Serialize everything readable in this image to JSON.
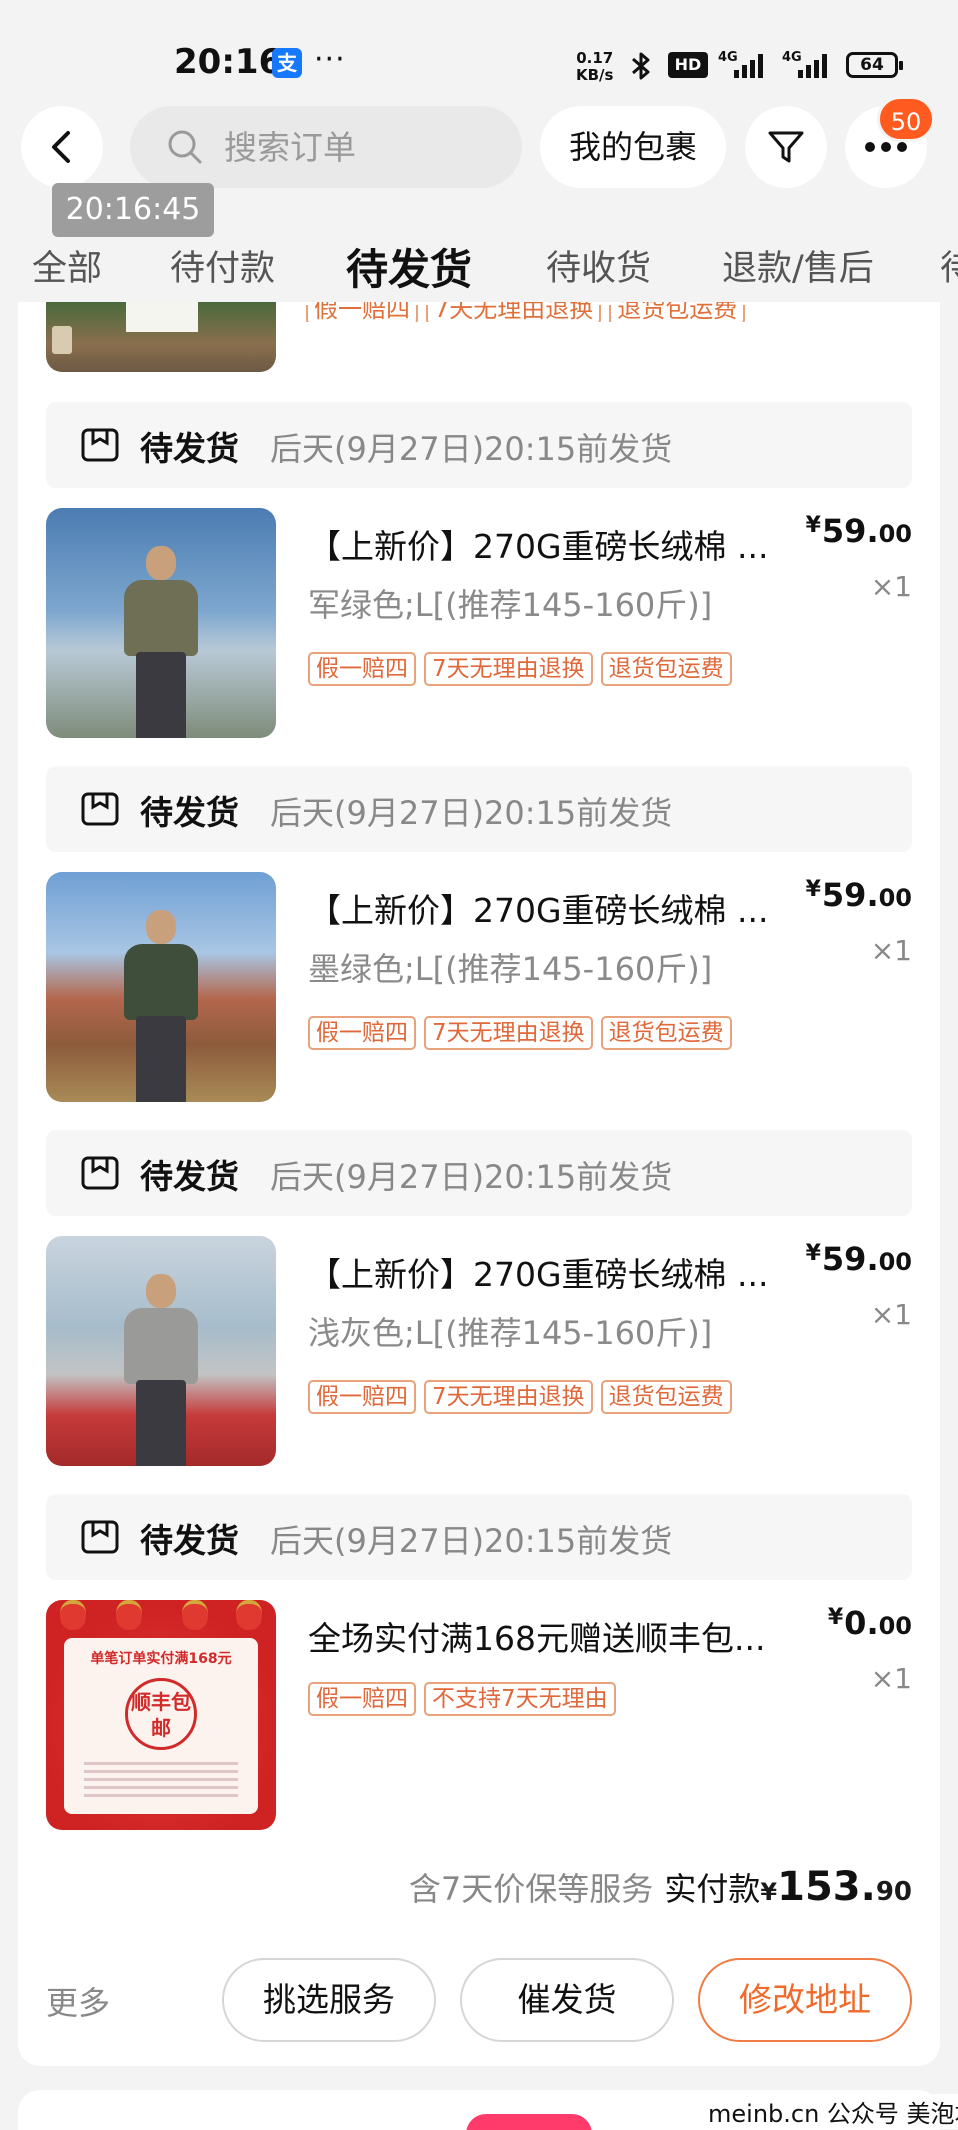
{
  "status_bar": {
    "time": "20:16",
    "app_icon_text": "支",
    "dots": "···",
    "net_speed_value": "0.17",
    "net_speed_unit": "KB/s",
    "hd": "HD",
    "signal_1": "4G",
    "signal_2": "4G",
    "battery": "64"
  },
  "header": {
    "search_placeholder": "搜索订单",
    "my_packages": "我的包裹",
    "more_badge": "50",
    "time_tip": "20:16:45"
  },
  "tabs": [
    {
      "label": "全部"
    },
    {
      "label": "待付款"
    },
    {
      "label": "待发货"
    },
    {
      "label": "待收货"
    },
    {
      "label": "退款/售后"
    },
    {
      "label": "待"
    }
  ],
  "top_cut_tags": [
    "假一赔四",
    "7天无理由退换",
    "退货包运费"
  ],
  "orders": [
    {
      "status": "待发货",
      "deadline": "后天(9月27日)20:15前发货",
      "title": "【上新价】270G重磅长绒棉 ...",
      "variant": "军绿色;L[(推荐145-160斤)]",
      "tags": [
        "假一赔四",
        "7天无理由退换",
        "退货包运费"
      ],
      "price_yen": "¥",
      "price_int": "59.",
      "price_dec": "00",
      "qty": "×1",
      "shirt_color": "#6e6f55"
    },
    {
      "status": "待发货",
      "deadline": "后天(9月27日)20:15前发货",
      "title": "【上新价】270G重磅长绒棉 ...",
      "variant": "墨绿色;L[(推荐145-160斤)]",
      "tags": [
        "假一赔四",
        "7天无理由退换",
        "退货包运费"
      ],
      "price_yen": "¥",
      "price_int": "59.",
      "price_dec": "00",
      "qty": "×1",
      "shirt_color": "#3f4d3b"
    },
    {
      "status": "待发货",
      "deadline": "后天(9月27日)20:15前发货",
      "title": "【上新价】270G重磅长绒棉 ...",
      "variant": "浅灰色;L[(推荐145-160斤)]",
      "tags": [
        "假一赔四",
        "7天无理由退换",
        "退货包运费"
      ],
      "price_yen": "¥",
      "price_int": "59.",
      "price_dec": "00",
      "qty": "×1",
      "shirt_color": "#9a9a98"
    },
    {
      "status": "待发货",
      "deadline": "后天(9月27日)20:15前发货",
      "title": "全场实付满168元赠送顺丰包...",
      "tags": [
        "假一赔四",
        "不支持7天无理由"
      ],
      "price_yen": "¥",
      "price_int": "0.",
      "price_dec": "00",
      "qty": "×1",
      "promo_line": "单笔订单实付满168元",
      "promo_seal": "顺丰包邮"
    }
  ],
  "summary": {
    "service": "含7天价保等服务",
    "paid_label": "实付款",
    "yen": "¥",
    "amount_int": "153.",
    "amount_dec": "90"
  },
  "actions": {
    "more": "更多",
    "select_service": "挑选服务",
    "urge_ship": "催发货",
    "modify_address": "修改地址"
  },
  "watermark": "meinb.cn 公众号 美泡君"
}
